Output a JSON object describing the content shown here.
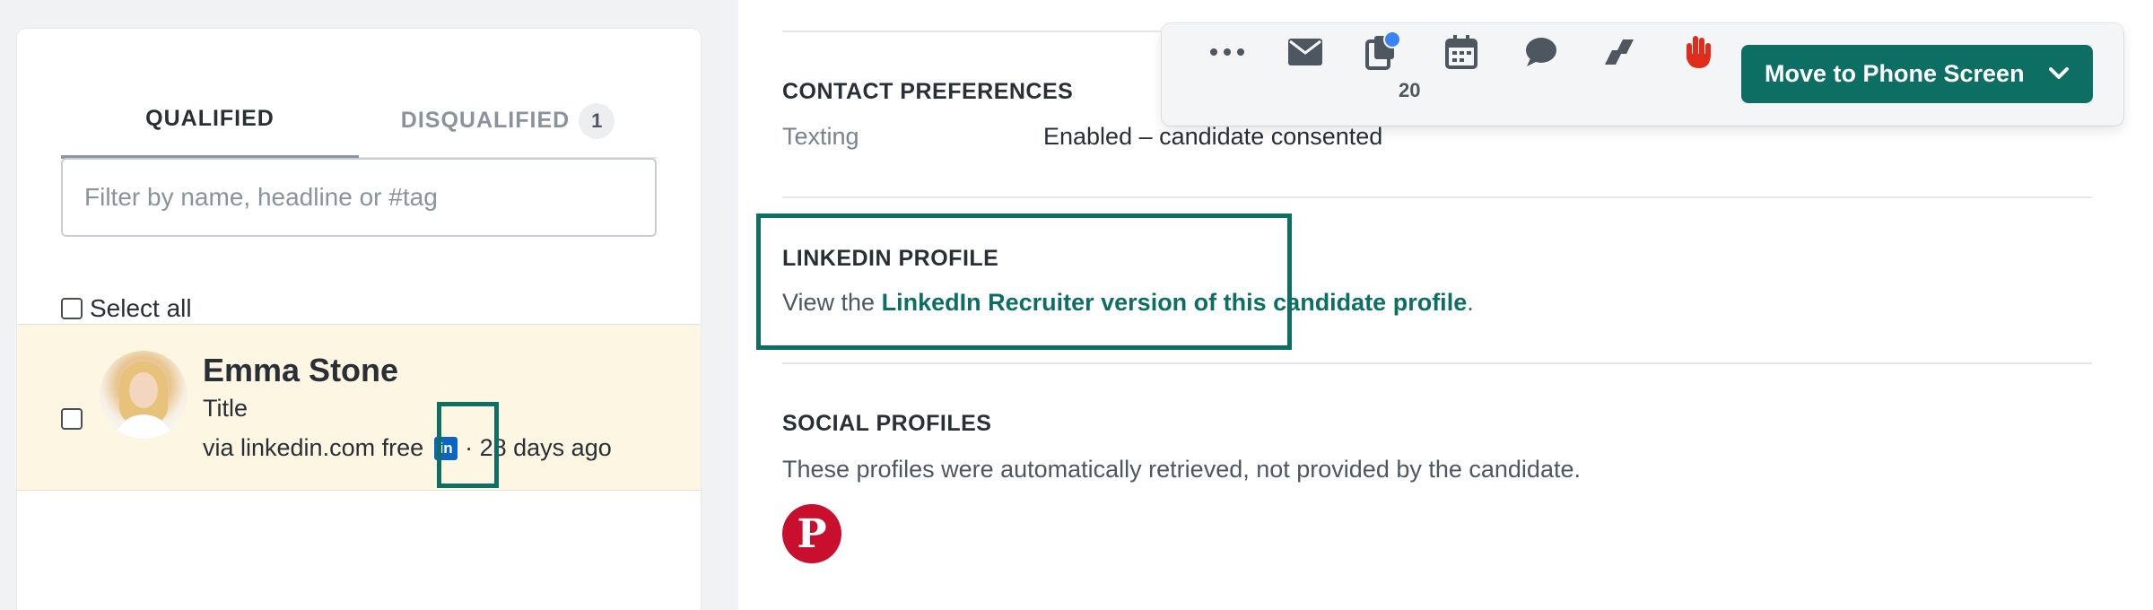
{
  "tabs": {
    "qualified": "QUALIFIED",
    "disqualified": "DISQUALIFIED",
    "disqualified_count": "1"
  },
  "filter": {
    "placeholder": "Filter by name, headline or #tag",
    "value": ""
  },
  "select_all_label": "Select all",
  "candidate": {
    "name": "Emma Stone",
    "title": "Title",
    "source": "via linkedin.com free",
    "linkedin_badge": "in",
    "time_ago": "· 28 days ago",
    "icon": "linkedin-icon"
  },
  "contact_preferences": {
    "heading": "CONTACT PREFERENCES",
    "label": "Texting",
    "value": "Enabled – candidate consented"
  },
  "linkedin_profile": {
    "heading": "LINKEDIN PROFILE",
    "prefix": "View the ",
    "link": "LinkedIn Recruiter version of this candidate profile",
    "suffix": "."
  },
  "social_profiles": {
    "heading": "SOCIAL PROFILES",
    "subtitle": "These profiles were automatically retrieved, not provided by the candidate.",
    "icons": [
      "pinterest-icon"
    ]
  },
  "toolbar": {
    "icons": [
      "more-icon",
      "email-icon",
      "documents-icon",
      "calendar-icon",
      "chat-icon",
      "transfer-icon",
      "stop-hand-icon"
    ],
    "documents_count": "20",
    "move_button": "Move to Phone Screen"
  },
  "colors": {
    "accent": "#0d6f64",
    "highlight_row": "#fdf6e3",
    "notification_dot": "#3b82f6",
    "stop_hand": "#e02d1b",
    "pinterest": "#c8102e"
  }
}
